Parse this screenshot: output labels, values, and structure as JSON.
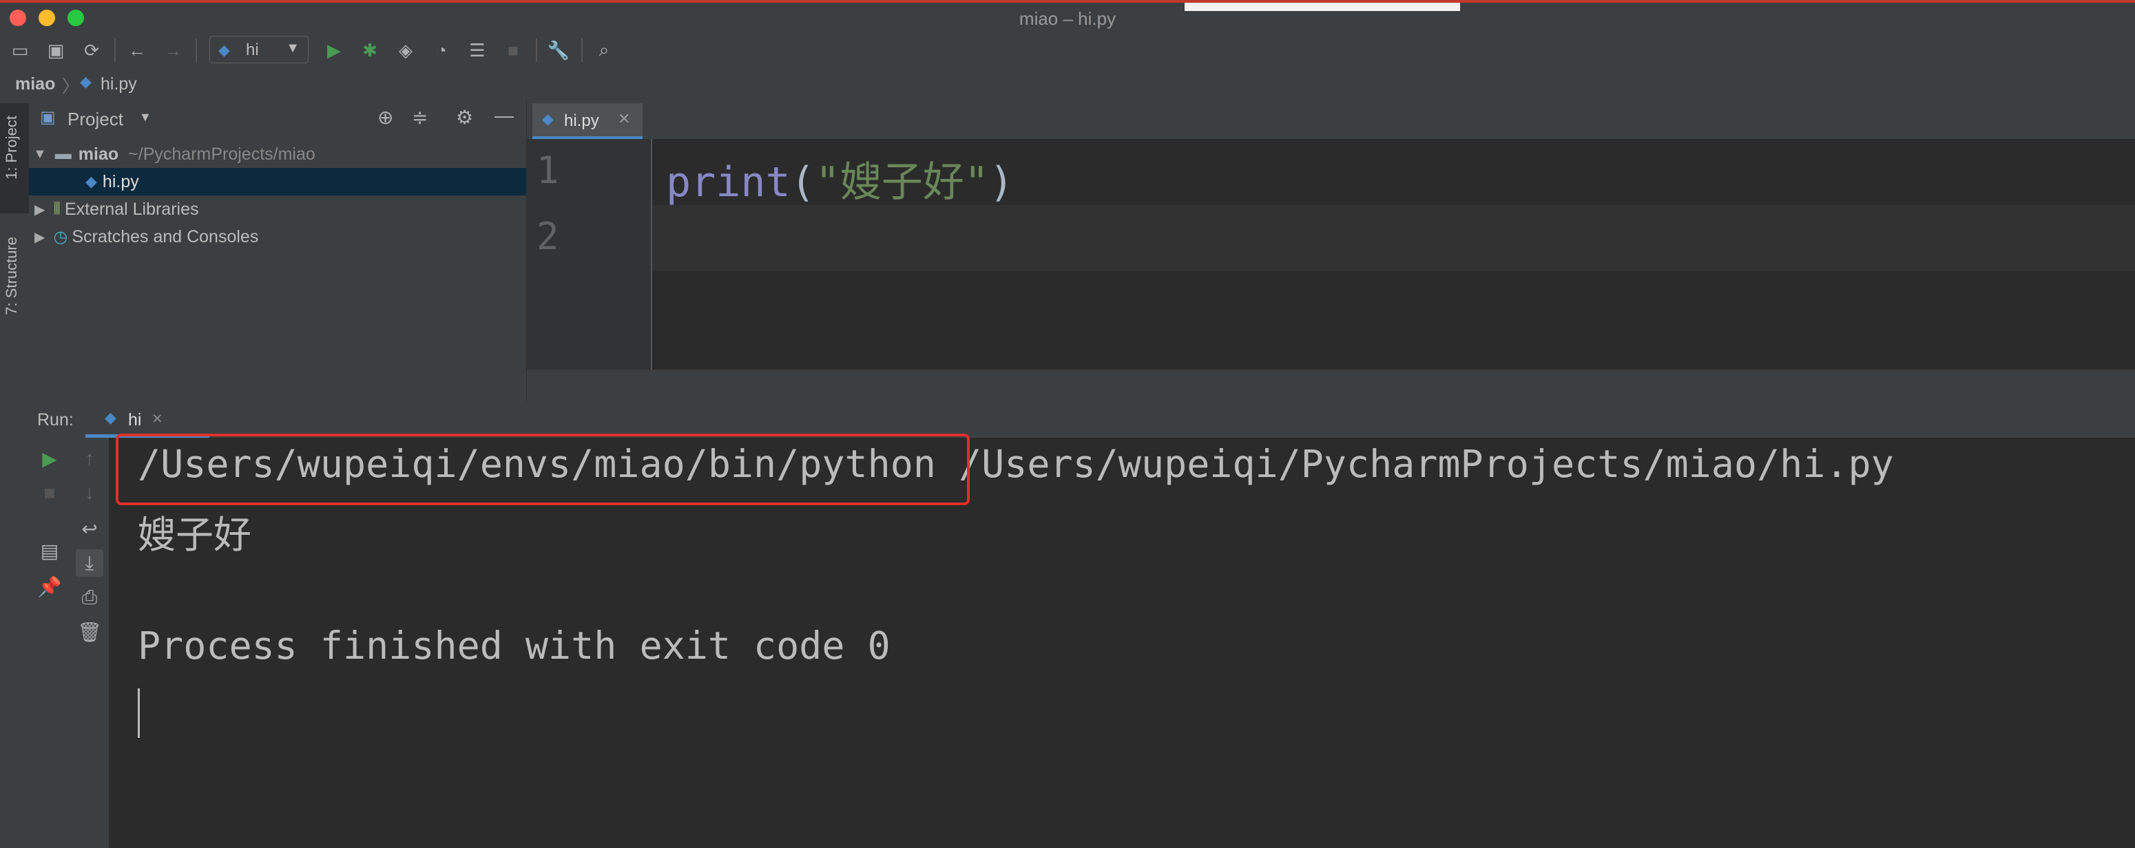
{
  "window": {
    "title": "miao – hi.py"
  },
  "toolbar": {
    "run_config": "hi"
  },
  "breadcrumb": {
    "project": "miao",
    "file": "hi.py"
  },
  "left_strip": {
    "project_tab": "1: Project",
    "structure_tab": "7: Structure"
  },
  "project_panel": {
    "title": "Project",
    "tree": {
      "root_name": "miao",
      "root_path": "~/PycharmProjects/miao",
      "file": "hi.py",
      "external": "External Libraries",
      "scratches": "Scratches and Consoles"
    }
  },
  "editor": {
    "tab": "hi.py",
    "line_numbers": [
      "1",
      "2"
    ],
    "code": {
      "func": "print",
      "open": "(",
      "string": "\"嫂子好\"",
      "close": ")"
    }
  },
  "run": {
    "label": "Run:",
    "tab": "hi",
    "console": {
      "interpreter": "/Users/wupeiqi/envs/miao/bin/python",
      "script": " /Users/wupeiqi/PycharmProjects/miao/hi.py",
      "output": "嫂子好",
      "exit": "Process finished with exit code 0"
    }
  },
  "colors": {
    "accent_red": "#e0302b",
    "selection": "#0d293e",
    "string": "#6a8759",
    "keyword": "#8888c6",
    "run_green": "#499c54"
  }
}
